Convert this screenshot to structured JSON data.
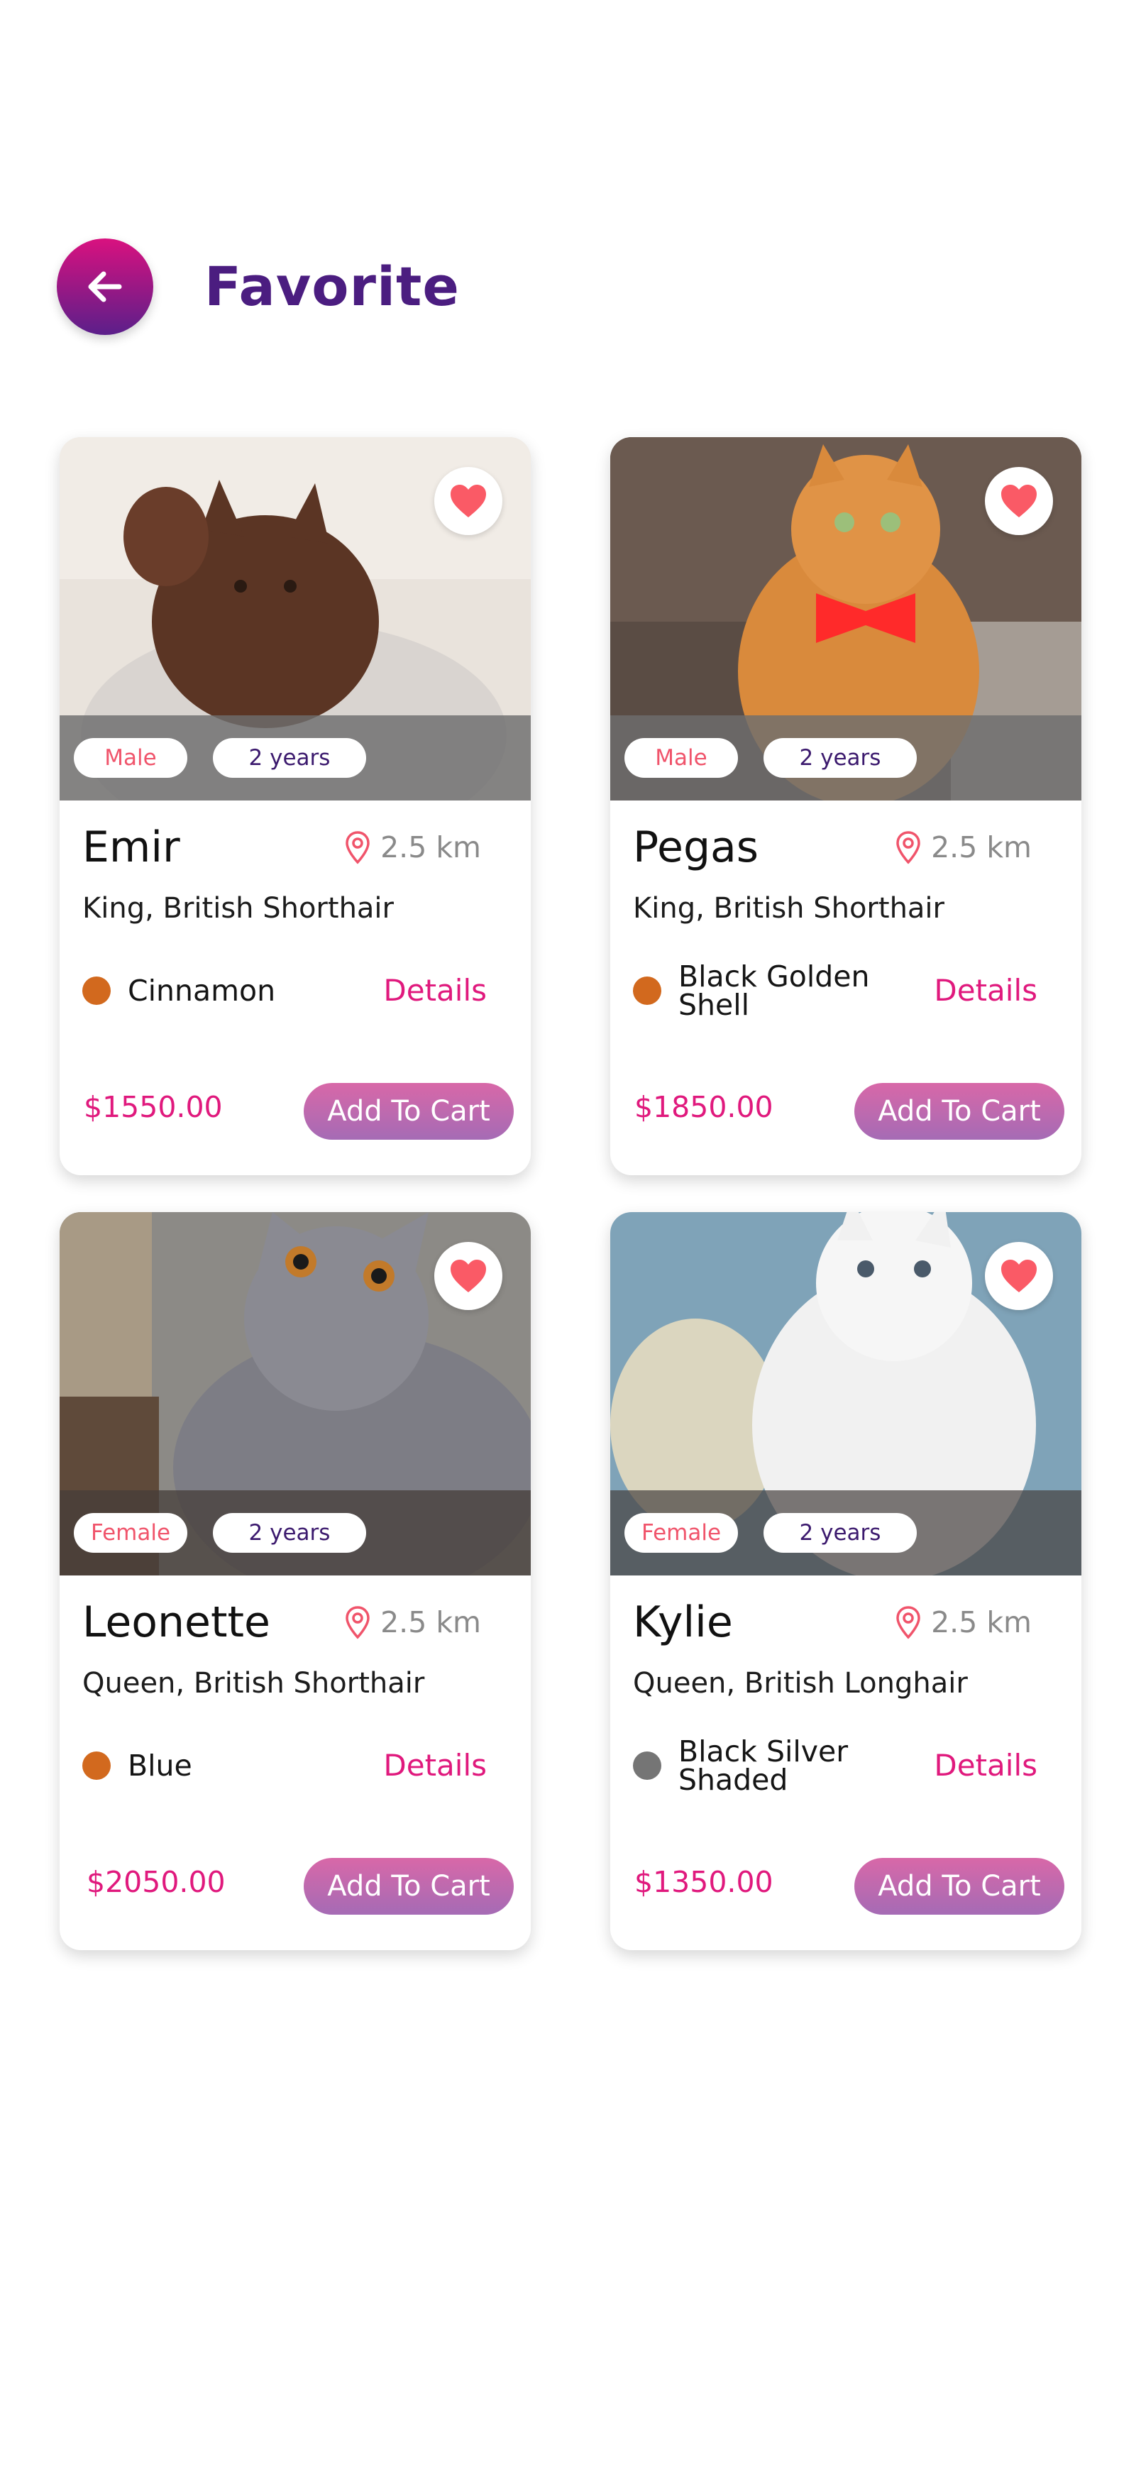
{
  "header": {
    "title": "Favorite",
    "back_icon": "arrow-left-icon",
    "back_gradient": [
      "#d9117f",
      "#5b1f8a"
    ]
  },
  "colors": {
    "accent": "#e0197d",
    "title": "#4b1d80",
    "heart": "#fa5a66"
  },
  "cards": [
    {
      "name": "Emir",
      "gender": "Male",
      "age": "2 years",
      "distance": "2.5 km",
      "breed": "King, British Shorthair",
      "color_name": "Cinnamon",
      "color_swatch": "#d2691e",
      "details_label": "Details",
      "price": "$1550.00",
      "cart_label": "Add To Cart",
      "favorite_icon": "heart-icon"
    },
    {
      "name": "Pegas",
      "gender": "Male",
      "age": "2 years",
      "distance": "2.5 km",
      "breed": "King, British Shorthair",
      "color_name": "Black Golden Shell",
      "color_swatch": "#d2691e",
      "details_label": "Details",
      "price": "$1850.00",
      "cart_label": "Add To Cart",
      "favorite_icon": "heart-icon"
    },
    {
      "name": "Leonette",
      "gender": "Female",
      "age": "2 years",
      "distance": "2.5 km",
      "breed": "Queen, British Shorthair",
      "color_name": "Blue",
      "color_swatch": "#d2691e",
      "details_label": "Details",
      "price": "$2050.00",
      "cart_label": "Add To Cart",
      "favorite_icon": "heart-icon"
    },
    {
      "name": "Kylie",
      "gender": "Female",
      "age": "2 years",
      "distance": "2.5 km",
      "breed": "Queen, British Longhair",
      "color_name": "Black Silver Shaded",
      "color_swatch": "#757575",
      "details_label": "Details",
      "price": "$1350.00",
      "cart_label": "Add To Cart",
      "favorite_icon": "heart-icon"
    }
  ]
}
